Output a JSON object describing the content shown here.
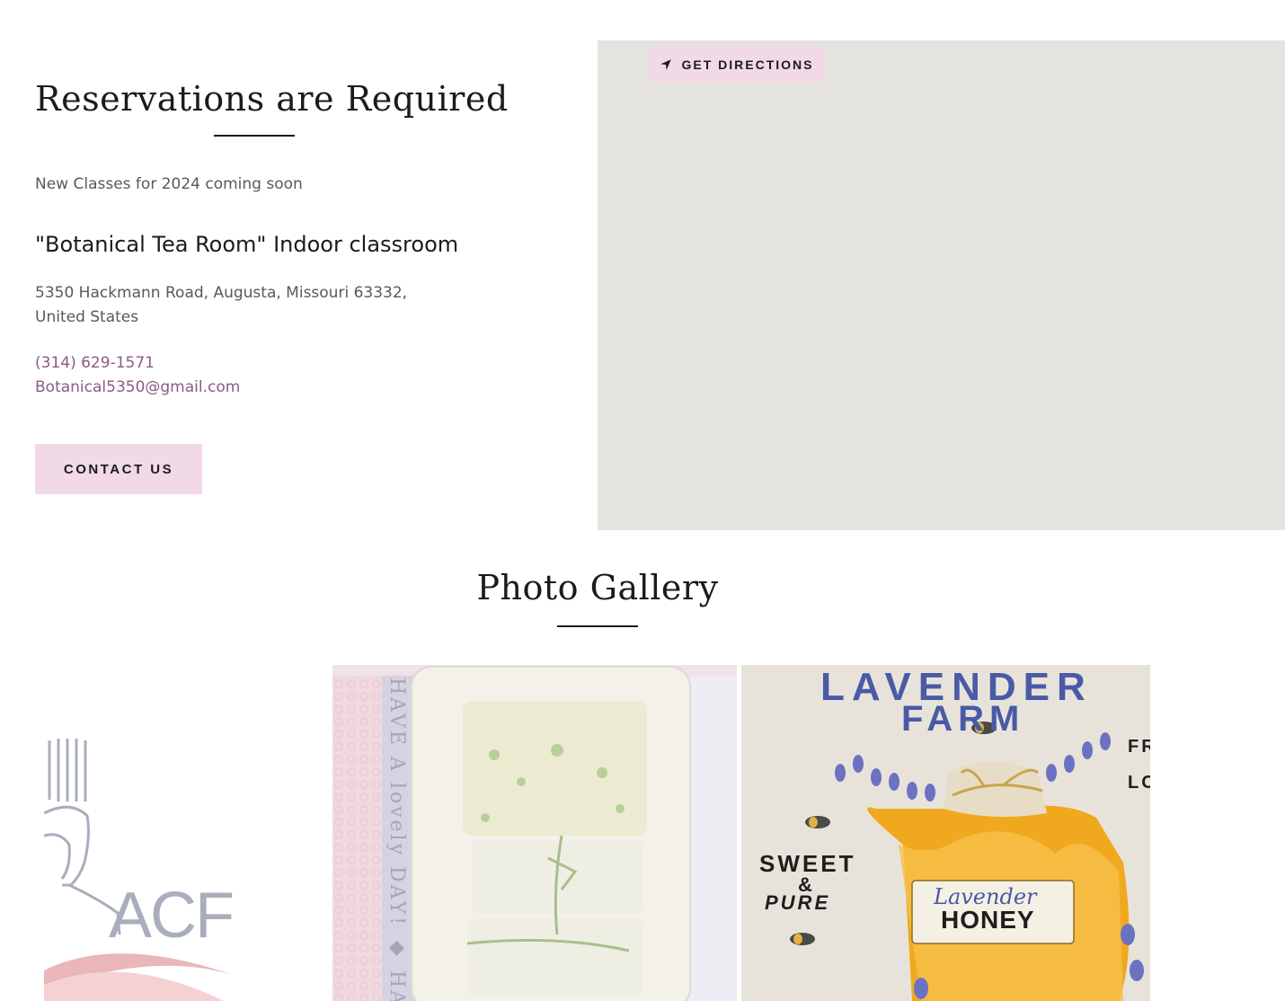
{
  "contact": {
    "title": "Reservations are Required",
    "note": "New Classes for 2024 coming soon",
    "venue": "\"Botanical Tea Room\" Indoor classroom",
    "address_line1": "5350 Hackmann Road, Augusta, Missouri 63332,",
    "address_line2": "United States",
    "phone": "(314) 629-1571",
    "email": "Botanical5350@gmail.com",
    "contact_button": "CONTACT US"
  },
  "map": {
    "directions_label": "GET DIRECTIONS",
    "directions_icon": "navigation-arrow-icon"
  },
  "gallery": {
    "title": "Photo Gallery",
    "photo1": {
      "logo_text": "ACF"
    },
    "photo2": {
      "side_text": "HAVE A lovely DAY! ◆ HAV"
    },
    "photo3": {
      "line1": "LAVENDER",
      "line2": "FARM",
      "side_left1": "SWEET",
      "side_left2": "&",
      "side_left3": "PURE",
      "label_script": "Lavender",
      "label_bold": "HONEY",
      "edge1": "FR",
      "edge2": "LO"
    }
  },
  "colors": {
    "accent": "#f2d9e8",
    "link": "#8c5a83",
    "map_bg": "#e4e3df",
    "text": "#1b1b1b"
  }
}
